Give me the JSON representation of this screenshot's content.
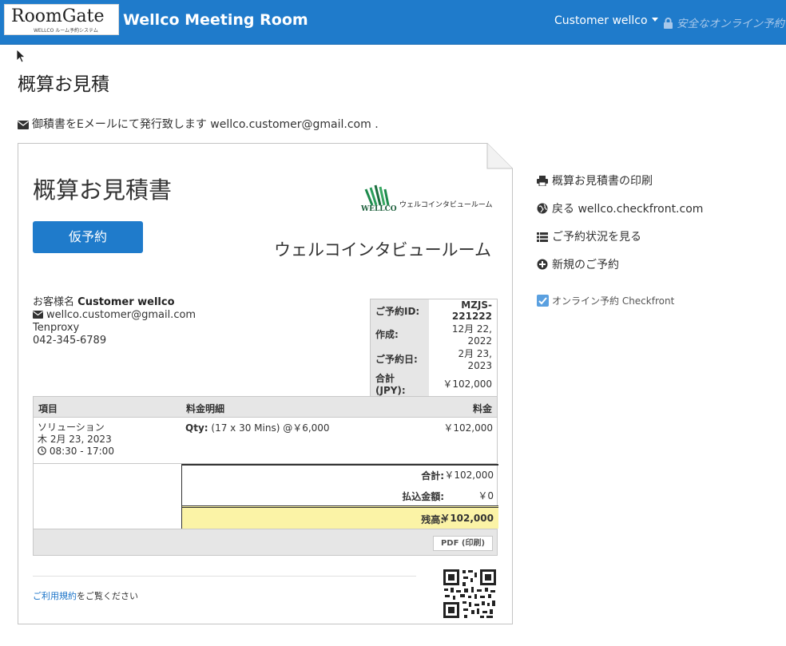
{
  "nav": {
    "logo_text": "RoomGate",
    "logo_subtitle": "WELLCO ルーム予約システム",
    "title": "Wellco Meeting Room",
    "user_menu": "Customer wellco",
    "secure_label": "安全なオンライン予約"
  },
  "page": {
    "title": "概算お見積",
    "email_note": "御積書をEメールにて発行致します wellco.customer@gmail.com ."
  },
  "document": {
    "title": "概算お見積書",
    "status_button": "仮予約",
    "company_logo_text": "ウェルコインタビュールーム",
    "company_logo_brand": "WELLCO",
    "company_name": "ウェルコインタビュールーム",
    "customer": {
      "label": "お客様名",
      "name": "Customer wellco",
      "email": "wellco.customer@gmail.com",
      "company": "Tenproxy",
      "phone": "042-345-6789"
    },
    "summary": [
      {
        "label": "ご予約ID:",
        "value": "MZJS-221222"
      },
      {
        "label": "作成:",
        "value": "12月 22, 2022"
      },
      {
        "label": "ご予約日:",
        "value": "2月 23, 2023"
      },
      {
        "label": "合計 (JPY):",
        "value": "￥102,000"
      }
    ],
    "items_header": {
      "item": "項目",
      "detail": "料金明細",
      "amount": "料金"
    },
    "items": [
      {
        "name": "ソリューション",
        "date": "木 2月 23, 2023",
        "time": "08:30 - 17:00",
        "qty_label": "Qty:",
        "qty_detail": "(17 x 30 Mins) @￥6,000",
        "amount": "￥102,000"
      }
    ],
    "totals": {
      "total_label": "合計:",
      "total_value": "￥102,000",
      "paid_label": "払込金額:",
      "paid_value": "￥0",
      "balance_label": "残高:",
      "balance_value": "￥102,000"
    },
    "pdf_button": "PDF (印刷)",
    "terms_link": "ご利用規約",
    "terms_suffix": "をご覧ください"
  },
  "side_menu": {
    "items": [
      {
        "icon": "print-icon",
        "label": "概算お見積書の印刷"
      },
      {
        "icon": "globe-icon",
        "label": "戻る wellco.checkfront.com"
      },
      {
        "icon": "list-icon",
        "label": "ご予約状況を見る"
      },
      {
        "icon": "plus-circle-icon",
        "label": "新規のご予約"
      }
    ],
    "badge_label": "オンライン予約 Checkfront"
  },
  "colors": {
    "nav_blue": "#1f7bcb",
    "balance_highlight": "#fbf3a6"
  }
}
